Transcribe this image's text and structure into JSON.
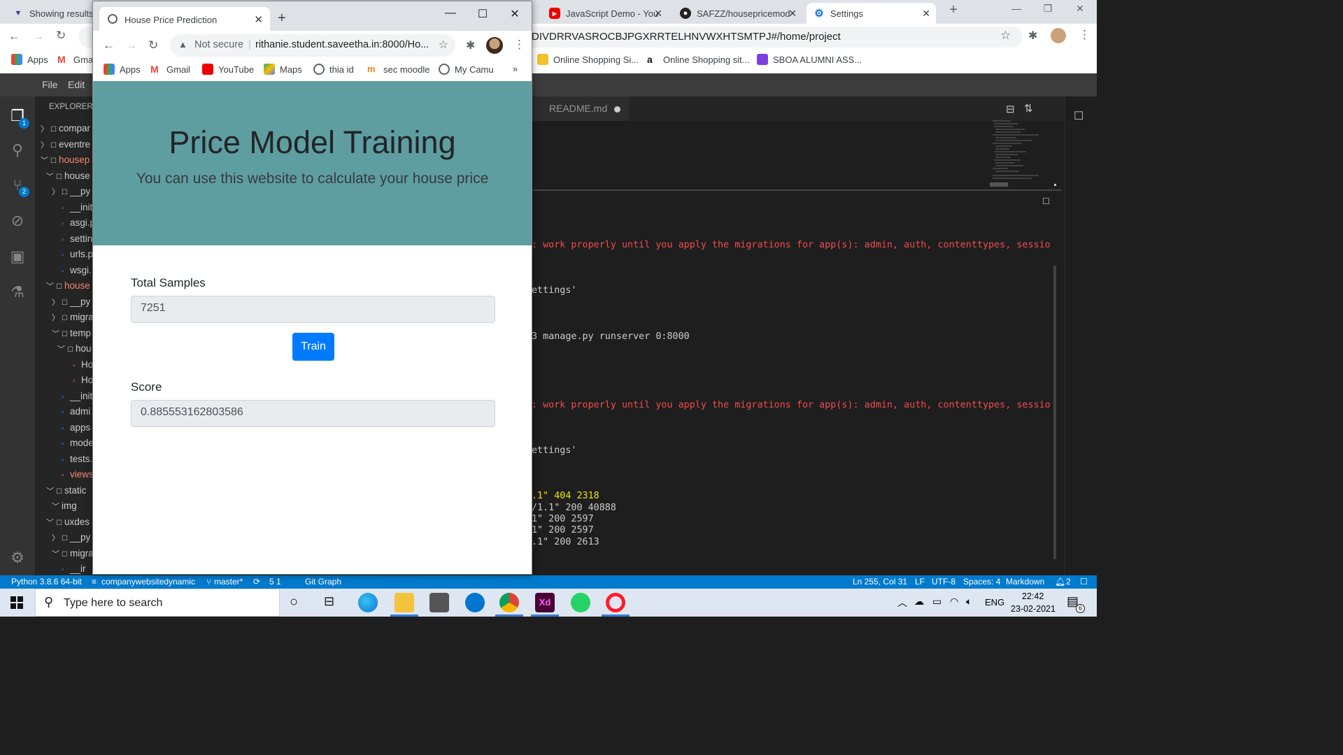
{
  "back_browser": {
    "tabs": [
      {
        "title": "Showing results"
      },
      {
        "title": "JavaScript Demo - You"
      },
      {
        "title": "SAFZZ/housepricemod"
      },
      {
        "title": "Settings"
      }
    ],
    "url_fragment": "DIVDRRVASROCBJPGXRRTELHNVWXHTSMTPJ#/home/project",
    "bookmarks": [
      {
        "label": "Apps"
      },
      {
        "label": "Gma"
      },
      {
        "label": "Online Shopping Si..."
      },
      {
        "label": "Online Shopping sit..."
      },
      {
        "label": "SBOA ALUMNI ASS..."
      }
    ]
  },
  "vscode": {
    "menu": {
      "file": "File",
      "edit": "Edit"
    },
    "activity_badges": {
      "explorer": "1",
      "scm": "2"
    },
    "explorer": {
      "title": "EXPLORER",
      "items": [
        {
          "label": "compar"
        },
        {
          "label": "eventre"
        },
        {
          "label": "housep"
        },
        {
          "label": "house"
        },
        {
          "label": "__py"
        },
        {
          "label": "__init"
        },
        {
          "label": "asgi.p"
        },
        {
          "label": "settin"
        },
        {
          "label": "urls.p"
        },
        {
          "label": "wsgi."
        },
        {
          "label": "house"
        },
        {
          "label": "__py"
        },
        {
          "label": "migra"
        },
        {
          "label": "temp"
        },
        {
          "label": "hou"
        },
        {
          "label": "Ho"
        },
        {
          "label": "Ho"
        },
        {
          "label": "__init"
        },
        {
          "label": "admi"
        },
        {
          "label": "apps"
        },
        {
          "label": "mode"
        },
        {
          "label": "tests."
        },
        {
          "label": "views"
        },
        {
          "label": "static"
        },
        {
          "label": "img"
        },
        {
          "label": "uxdes"
        },
        {
          "label": "__py"
        },
        {
          "label": "migra"
        },
        {
          "label": "__ir"
        }
      ]
    },
    "editor_tab": {
      "label": "README.md"
    },
    "terminal_lines": [
      {
        "text": ": work properly until you apply the migrations for app(s): admin, auth, contenttypes, sessio"
      },
      {
        "text": "ettings'"
      },
      {
        "text": "3 manage.py runserver 0:8000"
      },
      {
        "text": ": work properly until you apply the migrations for app(s): admin, auth, contenttypes, sessio"
      },
      {
        "text": "ettings'"
      },
      {
        "text": ".1\" 404 2318"
      },
      {
        "text": "/1.1\" 200 40888"
      },
      {
        "text": "1\" 200 2597"
      },
      {
        "text": "1\" 200 2597"
      },
      {
        "text": ".1\" 200 2613"
      }
    ],
    "status": {
      "python": "Python 3.8.6 64-bit",
      "db": "companywebsitedynamic",
      "branch": "master*",
      "sync": "5 1",
      "git_graph": "Git Graph",
      "position": "Ln 255, Col 31",
      "eol": "LF",
      "encoding": "UTF-8",
      "spaces": "Spaces: 4",
      "language": "Markdown",
      "notifications": "2"
    }
  },
  "front_browser": {
    "tab_title": "House Price Prediction",
    "security": "Not secure",
    "url": "rithanie.student.saveetha.in:8000/Ho...",
    "bookmarks": [
      {
        "label": "Apps"
      },
      {
        "label": "Gmail"
      },
      {
        "label": "YouTube"
      },
      {
        "label": "Maps"
      },
      {
        "label": "thia id"
      },
      {
        "label": "sec moodle"
      },
      {
        "label": "My Camu"
      }
    ],
    "more": "»"
  },
  "page": {
    "title": "Price Model Training",
    "subtitle": "You can use this website to calculate your house price",
    "samples_label": "Total Samples",
    "samples_value": "7251",
    "train_label": "Train",
    "score_label": "Score",
    "score_value": "0.885553162803586"
  },
  "taskbar": {
    "search_placeholder": "Type here to search",
    "lang": "ENG",
    "time": "22:42",
    "date": "23-02-2021",
    "notif_count": "6"
  },
  "colors": {
    "hero_bg": "#5f9ea0",
    "button_bg": "#007bff",
    "statusbar_bg": "#007acc",
    "terminal_error": "#f14c4c",
    "terminal_warn": "#e5e510"
  }
}
